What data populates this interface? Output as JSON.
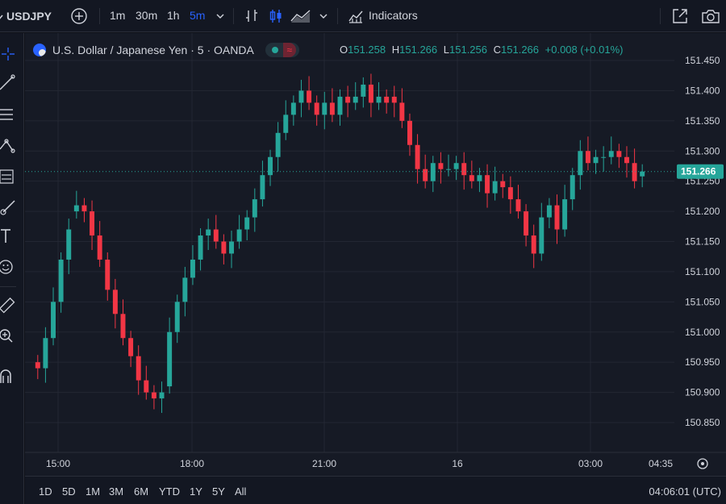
{
  "toolbar": {
    "symbol": "USDJPY",
    "intervals": [
      "1m",
      "30m",
      "1h",
      "5m"
    ],
    "active_interval": "5m",
    "indicators_label": "Indicators"
  },
  "legend": {
    "title": "U.S. Dollar / Japanese Yen · 5 · OANDA",
    "o_key": "O",
    "o_val": "151.258",
    "h_key": "H",
    "h_val": "151.266",
    "l_key": "L",
    "l_val": "151.256",
    "c_key": "C",
    "c_val": "151.266",
    "change": "+0.008 (+0.01%)"
  },
  "bottom": {
    "ranges": [
      "1D",
      "5D",
      "1M",
      "3M",
      "6M",
      "YTD",
      "1Y",
      "5Y",
      "All"
    ],
    "clock": "04:06:01 (UTC)"
  },
  "colors": {
    "up": "#26a69a",
    "down": "#f23645",
    "accent": "#2962ff",
    "price_tag": "#26a69a"
  },
  "chart_data": {
    "type": "candlestick",
    "symbol": "USDJPY",
    "interval": "5",
    "last_price": 151.266,
    "y_ticks": [
      "151.450",
      "151.400",
      "151.350",
      "151.300",
      "151.250",
      "151.200",
      "151.150",
      "151.100",
      "151.050",
      "151.000",
      "150.950",
      "150.900",
      "150.850"
    ],
    "x_ticks": [
      "15:00",
      "18:00",
      "21:00",
      "16",
      "03:00",
      "04:35"
    ],
    "grid": true,
    "closes": [
      150.94,
      150.99,
      151.05,
      151.12,
      151.17,
      151.21,
      151.2,
      151.16,
      151.12,
      151.07,
      151.03,
      150.99,
      150.96,
      150.92,
      150.9,
      150.89,
      150.9,
      151.0,
      151.05,
      151.09,
      151.12,
      151.16,
      151.17,
      151.15,
      151.13,
      151.15,
      151.17,
      151.19,
      151.22,
      151.26,
      151.29,
      151.33,
      151.36,
      151.38,
      151.4,
      151.38,
      151.36,
      151.38,
      151.36,
      151.39,
      151.38,
      151.39,
      151.41,
      151.38,
      151.39,
      151.38,
      151.38,
      151.35,
      151.31,
      151.27,
      151.25,
      151.28,
      151.27,
      151.27,
      151.28,
      151.26,
      151.25,
      151.26,
      151.23,
      151.25,
      151.24,
      151.22,
      151.2,
      151.16,
      151.13,
      151.19,
      151.21,
      151.17,
      151.22,
      151.26,
      151.3,
      151.28,
      151.29,
      151.29,
      151.3,
      151.29,
      151.28,
      151.25,
      151.266
    ],
    "opens": [
      150.95,
      150.94,
      150.99,
      151.05,
      151.12,
      151.2,
      151.21,
      151.2,
      151.16,
      151.12,
      151.07,
      151.03,
      150.99,
      150.96,
      150.92,
      150.9,
      150.89,
      150.91,
      151.0,
      151.05,
      151.09,
      151.12,
      151.16,
      151.17,
      151.15,
      151.13,
      151.15,
      151.17,
      151.19,
      151.22,
      151.26,
      151.29,
      151.33,
      151.36,
      151.38,
      151.4,
      151.38,
      151.36,
      151.38,
      151.36,
      151.39,
      151.38,
      151.39,
      151.41,
      151.38,
      151.39,
      151.39,
      151.38,
      151.35,
      151.31,
      151.27,
      151.25,
      151.28,
      151.27,
      151.27,
      151.28,
      151.26,
      151.25,
      151.26,
      151.23,
      151.25,
      151.24,
      151.22,
      151.2,
      151.16,
      151.13,
      151.19,
      151.21,
      151.17,
      151.22,
      151.26,
      151.3,
      151.28,
      151.29,
      151.29,
      151.3,
      151.29,
      151.28,
      151.258
    ]
  }
}
